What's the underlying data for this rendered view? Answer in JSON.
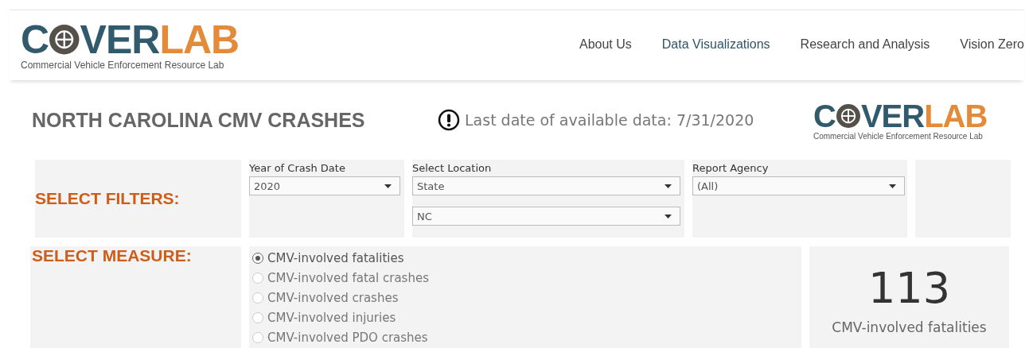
{
  "header": {
    "logo": {
      "first": "C",
      "middle": "VER",
      "last": "LAB",
      "subtitle": "Commercial Vehicle Enforcement Resource Lab"
    },
    "nav": [
      {
        "label": "About Us",
        "selected": false
      },
      {
        "label": "Data Visualizations",
        "selected": true
      },
      {
        "label": "Research and Analysis",
        "selected": false
      },
      {
        "label": "Vision Zero",
        "selected": false
      }
    ]
  },
  "dashboard": {
    "title": "NORTH CAROLINA CMV CRASHES",
    "notice": "Last date of available data: 7/31/2020",
    "logo": {
      "first": "C",
      "middle": "VER",
      "last": "LAB",
      "subtitle": "Commercial Vehicle Enforcement Resource Lab"
    },
    "filters_label": "SELECT FILTERS:",
    "filters": [
      {
        "label": "Year of Crash Date",
        "values": [
          "2020"
        ]
      },
      {
        "label": "Select Location",
        "values": [
          "State",
          "NC"
        ]
      },
      {
        "label": "Report Agency",
        "values": [
          "(All)"
        ]
      }
    ],
    "measure_label": "SELECT MEASURE:",
    "measures": [
      {
        "label": "CMV-involved fatalities",
        "selected": true
      },
      {
        "label": "CMV-involved fatal crashes",
        "selected": false
      },
      {
        "label": "CMV-involved crashes",
        "selected": false
      },
      {
        "label": "CMV-involved injuries",
        "selected": false
      },
      {
        "label": "CMV-involved PDO crashes",
        "selected": false
      }
    ],
    "kpi": {
      "value": "113",
      "label": "CMV-involved fatalities"
    }
  }
}
